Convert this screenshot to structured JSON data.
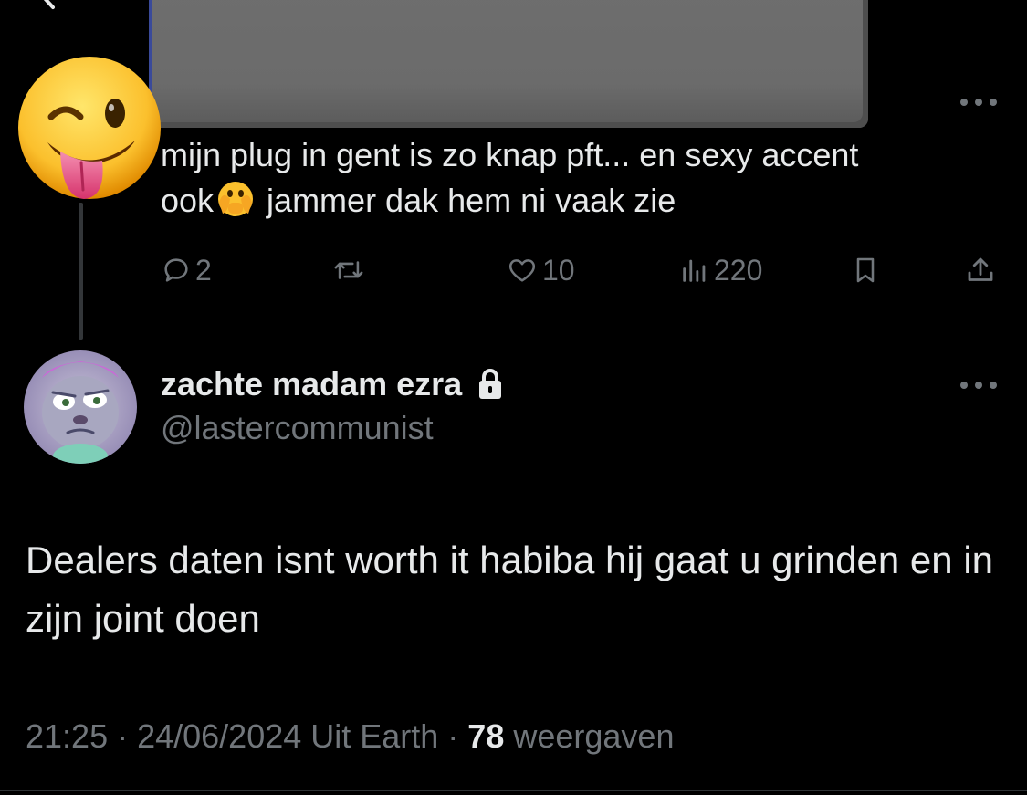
{
  "quoted_tweet": {
    "text_line1": "mijn plug in gent is zo knap pft... en sexy accent",
    "text_line2_before": "ook",
    "text_line2_after": " jammer dak hem ni vaak zie",
    "inline_emoji": "face-with-open-eyes-and-hand-over-mouth-icon",
    "avatar_emoji": "winking-face-with-tongue-icon",
    "actions": {
      "reply_count": "2",
      "retweet_count": "",
      "like_count": "10",
      "views_count": "220"
    }
  },
  "reply_tweet": {
    "display_name": "zachte madam ezra",
    "handle": "@lastercommunist",
    "protected_icon": "lock-icon",
    "text": "Dealers daten isnt worth it habiba hij gaat u grinden en in zijn joint doen",
    "timestamp": "21:25 · 24/06/2024 Uit Earth · ",
    "views_number": "78",
    "views_label": " weergaven"
  },
  "colors": {
    "background": "#000000",
    "text_primary": "#e7e9ea",
    "text_secondary": "#71767b",
    "thread_line": "#333639"
  }
}
